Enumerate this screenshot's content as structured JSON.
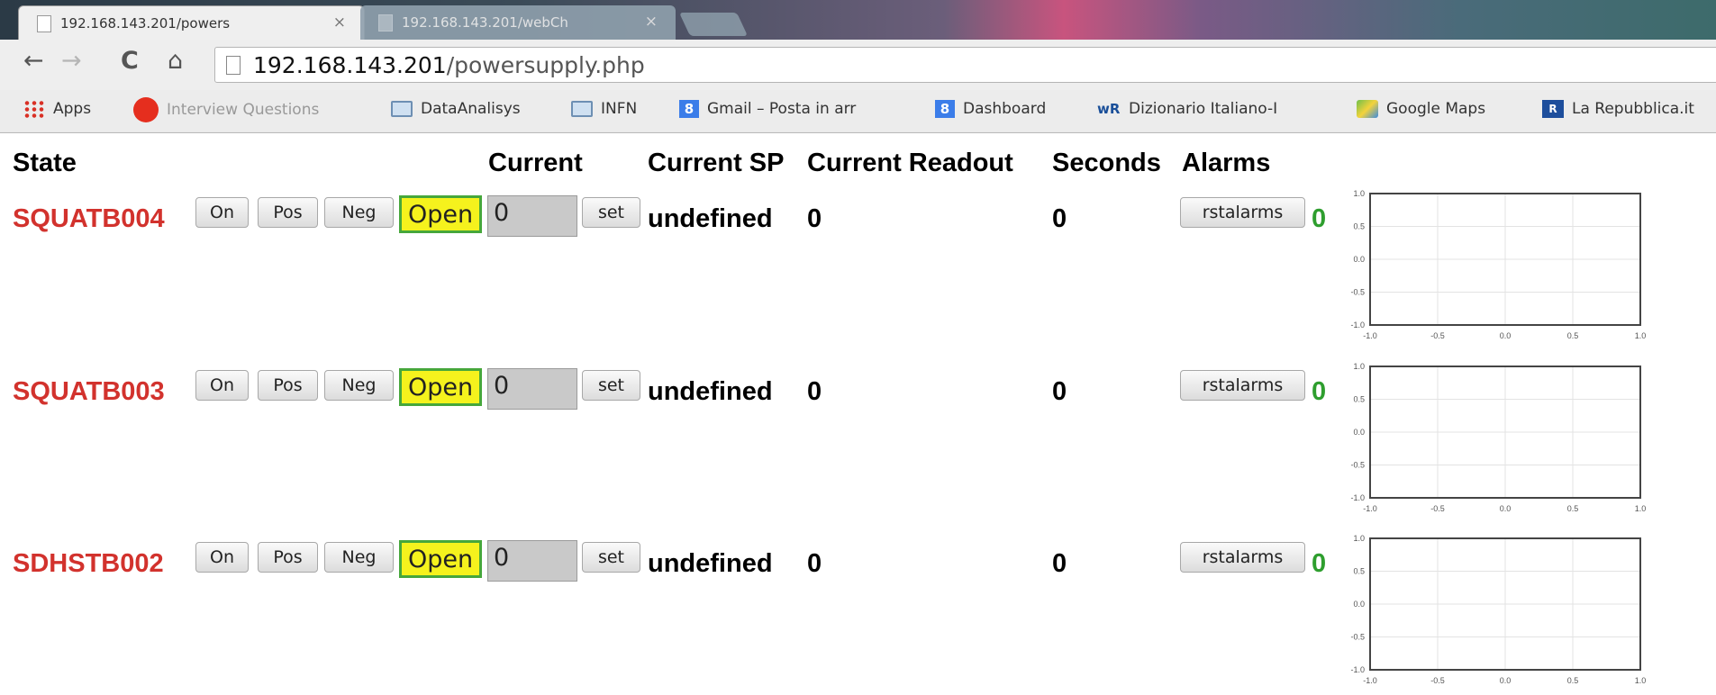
{
  "browser": {
    "tabs": [
      {
        "label": "192.168.143.201/powers",
        "active": true
      },
      {
        "label": "192.168.143.201/webCh",
        "active": false
      }
    ],
    "tab_close_glyph": "×",
    "nav": {
      "back": "←",
      "forward": "→",
      "reload": "C",
      "home": "⌂"
    },
    "url_host": "192.168.143.201",
    "url_path": "/powersupply.php",
    "bookmarks": [
      {
        "label": "Apps",
        "icon": "apps-grid-icon"
      },
      {
        "label": "Interview Questions",
        "icon": "red-dot-icon"
      },
      {
        "label": "DataAnalisys",
        "icon": "folder-icon"
      },
      {
        "label": "INFN",
        "icon": "folder-icon"
      },
      {
        "label": "Gmail – Posta in arr",
        "icon": "google-icon"
      },
      {
        "label": "Dashboard",
        "icon": "google-icon"
      },
      {
        "label": "Dizionario Italiano-I",
        "icon": "wr-icon"
      },
      {
        "label": "Google Maps",
        "icon": "maps-icon"
      },
      {
        "label": "La Repubblica.it",
        "icon": "repubblica-icon"
      }
    ]
  },
  "table": {
    "headers": {
      "state": "State",
      "current": "Current",
      "current_sp": "Current SP",
      "current_readout": "Current Readout",
      "seconds": "Seconds",
      "alarms": "Alarms"
    },
    "buttons": {
      "on": "On",
      "pos": "Pos",
      "neg": "Neg",
      "open": "Open",
      "set": "set",
      "rstalarms": "rstalarms"
    },
    "colors": {
      "name": "#d2322d",
      "open_bg": "#f5f21d",
      "open_border": "#46a73b",
      "alarm_ok": "#2e9e2e"
    },
    "rows": [
      {
        "name": "SQUATB004",
        "current_input": "0",
        "current_sp": "undefined",
        "readout": "0",
        "seconds": "0",
        "alarm_count": "0"
      },
      {
        "name": "SQUATB003",
        "current_input": "0",
        "current_sp": "undefined",
        "readout": "0",
        "seconds": "0",
        "alarm_count": "0"
      },
      {
        "name": "SDHSTB002",
        "current_input": "0",
        "current_sp": "undefined",
        "readout": "0",
        "seconds": "0",
        "alarm_count": "0"
      }
    ]
  },
  "chart_data": [
    {
      "type": "line",
      "series": [],
      "xlim": [
        -1.0,
        1.0
      ],
      "ylim": [
        -1.0,
        1.0
      ],
      "xticks": [
        "-1.0",
        "-0.5",
        "0.0",
        "0.5",
        "1.0"
      ],
      "yticks": [
        "1.0",
        "0.5",
        "0.0",
        "-0.5",
        "-1.0"
      ],
      "grid": true
    },
    {
      "type": "line",
      "series": [],
      "xlim": [
        -1.0,
        1.0
      ],
      "ylim": [
        -1.0,
        1.0
      ],
      "xticks": [
        "-1.0",
        "-0.5",
        "0.0",
        "0.5",
        "1.0"
      ],
      "yticks": [
        "1.0",
        "0.5",
        "0.0",
        "-0.5",
        "-1.0"
      ],
      "grid": true
    },
    {
      "type": "line",
      "series": [],
      "xlim": [
        -1.0,
        1.0
      ],
      "ylim": [
        -1.0,
        1.0
      ],
      "xticks": [
        "-1.0",
        "-0.5",
        "0.0",
        "0.5",
        "1.0"
      ],
      "yticks": [
        "1.0",
        "0.5",
        "0.0",
        "-0.5",
        "-1.0"
      ],
      "grid": true
    }
  ]
}
